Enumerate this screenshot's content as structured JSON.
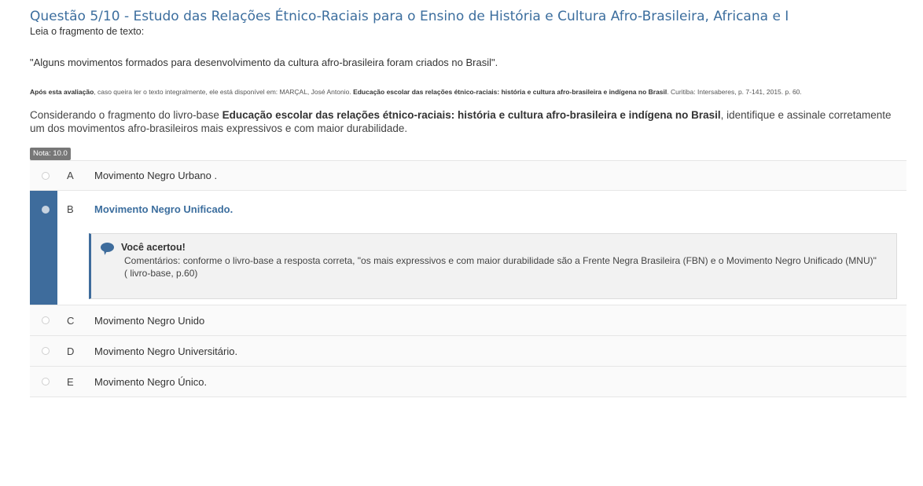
{
  "question": {
    "title": "Questão 5/10 - Estudo das Relações Étnico-Raciais para o Ensino de História e Cultura Afro-Brasileira, Africana e I",
    "instruction": "Leia o fragmento de texto:",
    "fragment": "\"Alguns movimentos formados para desenvolvimento  da cultura afro-brasileira foram criados no Brasil\".",
    "reference": {
      "lead_bold": "Após esta avaliação",
      "lead_rest": ", caso queira ler o texto integralmente, ele está disponível em: MARÇAL, José Antonio. ",
      "book_bold": "Educação escolar das relações étnico-raciais: história e cultura afro-brasileira e indígena no Brasil",
      "tail": ". Curitiba: Intersaberes, p. 7-141, 2015. p. 60."
    },
    "prompt": {
      "lead": "Considerando o fragmento do livro-base ",
      "book_bold": "Educação escolar das relações étnico-raciais: história e cultura afro-brasileira e indígena no Brasil",
      "tail": ", identifique e assinale corretamente um dos movimentos afro-brasileiros mais expressivos e com maior durabilidade."
    },
    "grade": "Nota: 10.0"
  },
  "options": [
    {
      "letter": "A",
      "text": "Movimento Negro  Urbano ."
    },
    {
      "letter": "B",
      "text": "Movimento Negro Unificado."
    },
    {
      "letter": "C",
      "text": "Movimento Negro Unido"
    },
    {
      "letter": "D",
      "text": "Movimento Negro Universitário."
    },
    {
      "letter": "E",
      "text": "Movimento Negro  Único."
    }
  ],
  "feedback": {
    "icon": "speech-bubble-icon",
    "status": "Você acertou!",
    "comment": "Comentários: conforme o livro-base a resposta correta, \"os mais expressivos  e com maior durabilidade são a Frente Negra Brasileira (FBN) e o Movimento  Negro Unificado (MNU)\" ( livro-base, p.60)"
  },
  "colors": {
    "accent": "#3e6c9c",
    "title": "#3c6e9e",
    "badge": "#777777"
  }
}
